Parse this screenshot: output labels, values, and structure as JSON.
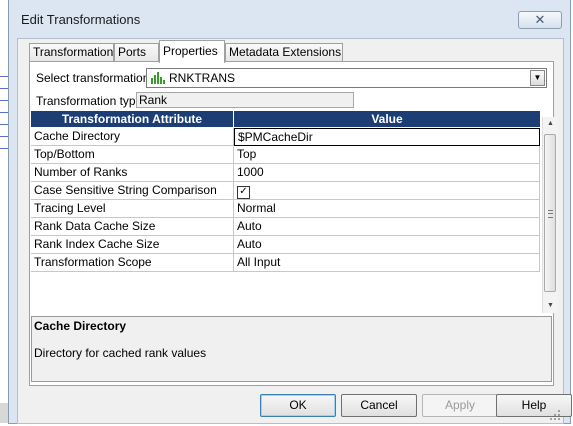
{
  "window": {
    "title": "Edit Transformations",
    "close_glyph": "✕"
  },
  "tabs": [
    {
      "label": "Transformation",
      "active": false
    },
    {
      "label": "Ports",
      "active": false
    },
    {
      "label": "Properties",
      "active": true
    },
    {
      "label": "Metadata Extensions",
      "active": false
    }
  ],
  "select": {
    "label": "Select transformation:",
    "value": "RNKTRANS",
    "icon": "rank-transformation-icon"
  },
  "type": {
    "label": "Transformation type:",
    "value": "Rank"
  },
  "grid": {
    "headers": [
      "Transformation Attribute",
      "Value"
    ],
    "rows": [
      {
        "attribute": "Cache Directory",
        "value": "$PMCacheDir"
      },
      {
        "attribute": "Top/Bottom",
        "value": "Top"
      },
      {
        "attribute": "Number of Ranks",
        "value": "1000"
      },
      {
        "attribute": "Case Sensitive String Comparison",
        "value": "",
        "checked": true
      },
      {
        "attribute": "Tracing Level",
        "value": "Normal"
      },
      {
        "attribute": "Rank Data Cache Size",
        "value": "Auto"
      },
      {
        "attribute": "Rank Index Cache Size",
        "value": "Auto"
      },
      {
        "attribute": "Transformation Scope",
        "value": "All Input"
      }
    ],
    "header_color": "#1c3e75"
  },
  "description": {
    "title": "Cache Directory",
    "text": "Directory for cached rank values"
  },
  "buttons": {
    "ok": "OK",
    "cancel": "Cancel",
    "apply": "Apply",
    "help": "Help"
  }
}
